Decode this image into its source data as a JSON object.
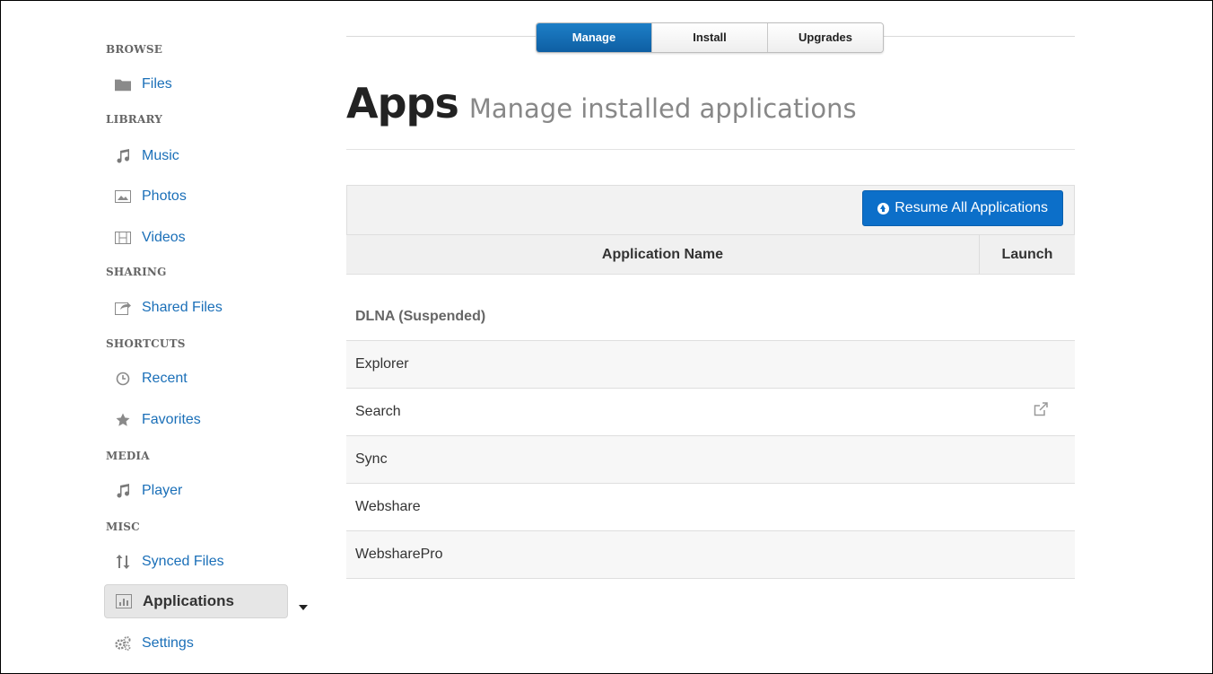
{
  "sidebar": {
    "sections": [
      {
        "header": "BROWSE",
        "items": [
          {
            "label": "Files",
            "icon": "folder-icon"
          }
        ]
      },
      {
        "header": "LIBRARY",
        "items": [
          {
            "label": "Music",
            "icon": "music-note-icon"
          },
          {
            "label": "Photos",
            "icon": "photo-icon"
          },
          {
            "label": "Videos",
            "icon": "film-icon"
          }
        ]
      },
      {
        "header": "SHARING",
        "items": [
          {
            "label": "Shared Files",
            "icon": "share-icon"
          }
        ]
      },
      {
        "header": "SHORTCUTS",
        "items": [
          {
            "label": "Recent",
            "icon": "clock-icon"
          },
          {
            "label": "Favorites",
            "icon": "star-icon"
          }
        ]
      },
      {
        "header": "MEDIA",
        "items": [
          {
            "label": "Player",
            "icon": "music-note-icon"
          }
        ]
      },
      {
        "header": "MISC",
        "items": [
          {
            "label": "Synced Files",
            "icon": "sync-arrows-icon"
          },
          {
            "label": "Applications",
            "icon": "bar-chart-icon",
            "active": true
          },
          {
            "label": "Settings",
            "icon": "gears-icon"
          }
        ]
      }
    ]
  },
  "tabs": [
    {
      "label": "Manage",
      "active": true
    },
    {
      "label": "Install",
      "active": false
    },
    {
      "label": "Upgrades",
      "active": false
    }
  ],
  "page": {
    "title": "Apps",
    "subtitle": "Manage installed applications"
  },
  "toolbar": {
    "resume_label": "Resume All Applications"
  },
  "table": {
    "columns": [
      "Application Name",
      "Launch"
    ],
    "rows": [
      {
        "name": "DLNA (Suspended)",
        "suspended": true,
        "launch": false
      },
      {
        "name": "Explorer",
        "launch": false
      },
      {
        "name": "Search",
        "launch": true
      },
      {
        "name": "Sync",
        "launch": false
      },
      {
        "name": "Webshare",
        "launch": false
      },
      {
        "name": "WebsharePro",
        "launch": false
      }
    ]
  },
  "colors": {
    "accent": "#0c6fc9",
    "link": "#1a6fb8",
    "icon_gray": "#8a8a8a"
  }
}
